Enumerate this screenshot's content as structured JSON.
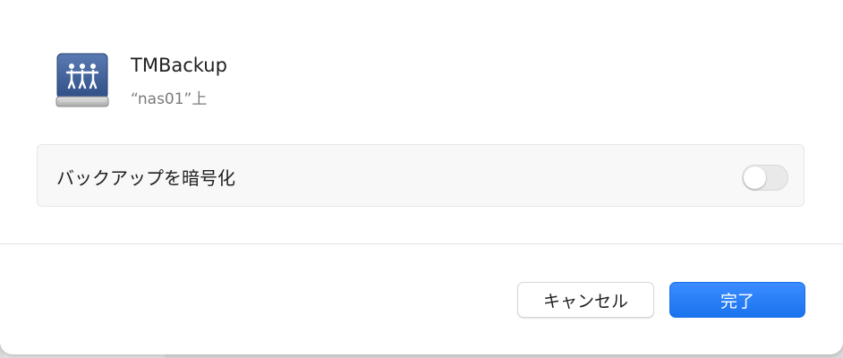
{
  "volume": {
    "name": "TMBackup",
    "location": "“nas01”上",
    "icon": "network-drive-icon"
  },
  "options": {
    "encrypt_label": "バックアップを暗号化",
    "encrypt_enabled": false
  },
  "buttons": {
    "cancel_label": "キャンセル",
    "done_label": "完了"
  },
  "colors": {
    "accent": "#1a73ef",
    "toggle_off": "#e9e9e9"
  }
}
